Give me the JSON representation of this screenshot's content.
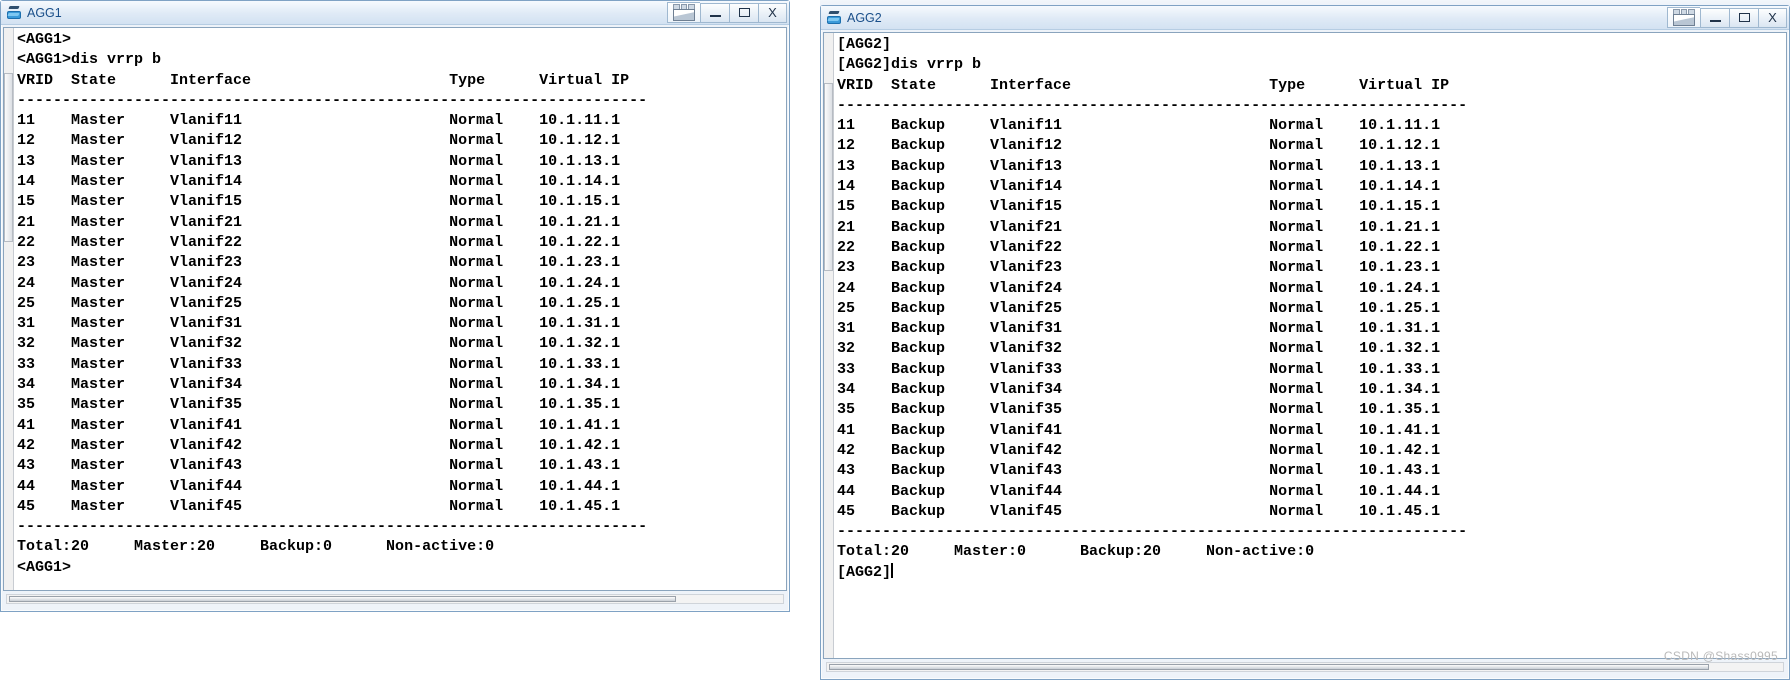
{
  "background_app": {
    "toolbar_hint": "▭ ▤ ▥ ▦ ▧ ▨ ▩ ▭ ▤ ▥ ▦ ▧ ▨ ▩ ▭ ▤ ▥ ▦ ▧ ▨ ▩ ▭ ▤ ▥ ▦ ▧ ▨"
  },
  "windows": [
    {
      "id": "agg1",
      "title": "AGG1",
      "icon": "ensp-device-icon",
      "buttons": {
        "restore": "restore",
        "minimize": "–",
        "maximize": "▭",
        "close": "X"
      },
      "terminal": {
        "prompt_first": "<AGG1>",
        "command_line": "<AGG1>dis vrrp b",
        "header": "VRID  State      Interface                      Type      Virtual IP",
        "divider": "----------------------------------------------------------------------",
        "summary": "Total:20     Master:20     Backup:0      Non-active:0",
        "prompt_last": "<AGG1>",
        "columns": [
          "VRID",
          "State",
          "Interface",
          "Type",
          "Virtual IP"
        ],
        "rows": [
          [
            "11",
            "Master",
            "Vlanif11",
            "Normal",
            "10.1.11.1"
          ],
          [
            "12",
            "Master",
            "Vlanif12",
            "Normal",
            "10.1.12.1"
          ],
          [
            "13",
            "Master",
            "Vlanif13",
            "Normal",
            "10.1.13.1"
          ],
          [
            "14",
            "Master",
            "Vlanif14",
            "Normal",
            "10.1.14.1"
          ],
          [
            "15",
            "Master",
            "Vlanif15",
            "Normal",
            "10.1.15.1"
          ],
          [
            "21",
            "Master",
            "Vlanif21",
            "Normal",
            "10.1.21.1"
          ],
          [
            "22",
            "Master",
            "Vlanif22",
            "Normal",
            "10.1.22.1"
          ],
          [
            "23",
            "Master",
            "Vlanif23",
            "Normal",
            "10.1.23.1"
          ],
          [
            "24",
            "Master",
            "Vlanif24",
            "Normal",
            "10.1.24.1"
          ],
          [
            "25",
            "Master",
            "Vlanif25",
            "Normal",
            "10.1.25.1"
          ],
          [
            "31",
            "Master",
            "Vlanif31",
            "Normal",
            "10.1.31.1"
          ],
          [
            "32",
            "Master",
            "Vlanif32",
            "Normal",
            "10.1.32.1"
          ],
          [
            "33",
            "Master",
            "Vlanif33",
            "Normal",
            "10.1.33.1"
          ],
          [
            "34",
            "Master",
            "Vlanif34",
            "Normal",
            "10.1.34.1"
          ],
          [
            "35",
            "Master",
            "Vlanif35",
            "Normal",
            "10.1.35.1"
          ],
          [
            "41",
            "Master",
            "Vlanif41",
            "Normal",
            "10.1.41.1"
          ],
          [
            "42",
            "Master",
            "Vlanif42",
            "Normal",
            "10.1.42.1"
          ],
          [
            "43",
            "Master",
            "Vlanif43",
            "Normal",
            "10.1.43.1"
          ],
          [
            "44",
            "Master",
            "Vlanif44",
            "Normal",
            "10.1.44.1"
          ],
          [
            "45",
            "Master",
            "Vlanif45",
            "Normal",
            "10.1.45.1"
          ]
        ],
        "totals": {
          "total": "20",
          "master": "20",
          "backup": "0",
          "non_active": "0"
        }
      }
    },
    {
      "id": "agg2",
      "title": "AGG2",
      "icon": "ensp-device-icon",
      "buttons": {
        "restore": "restore",
        "minimize": "–",
        "maximize": "▭",
        "close": "X"
      },
      "terminal": {
        "prompt_first": "[AGG2]",
        "command_line": "[AGG2]dis vrrp b",
        "header": "VRID  State      Interface                      Type      Virtual IP",
        "divider": "----------------------------------------------------------------------",
        "summary": "Total:20     Master:0      Backup:20     Non-active:0",
        "prompt_last": "[AGG2]",
        "columns": [
          "VRID",
          "State",
          "Interface",
          "Type",
          "Virtual IP"
        ],
        "rows": [
          [
            "11",
            "Backup",
            "Vlanif11",
            "Normal",
            "10.1.11.1"
          ],
          [
            "12",
            "Backup",
            "Vlanif12",
            "Normal",
            "10.1.12.1"
          ],
          [
            "13",
            "Backup",
            "Vlanif13",
            "Normal",
            "10.1.13.1"
          ],
          [
            "14",
            "Backup",
            "Vlanif14",
            "Normal",
            "10.1.14.1"
          ],
          [
            "15",
            "Backup",
            "Vlanif15",
            "Normal",
            "10.1.15.1"
          ],
          [
            "21",
            "Backup",
            "Vlanif21",
            "Normal",
            "10.1.21.1"
          ],
          [
            "22",
            "Backup",
            "Vlanif22",
            "Normal",
            "10.1.22.1"
          ],
          [
            "23",
            "Backup",
            "Vlanif23",
            "Normal",
            "10.1.23.1"
          ],
          [
            "24",
            "Backup",
            "Vlanif24",
            "Normal",
            "10.1.24.1"
          ],
          [
            "25",
            "Backup",
            "Vlanif25",
            "Normal",
            "10.1.25.1"
          ],
          [
            "31",
            "Backup",
            "Vlanif31",
            "Normal",
            "10.1.31.1"
          ],
          [
            "32",
            "Backup",
            "Vlanif32",
            "Normal",
            "10.1.32.1"
          ],
          [
            "33",
            "Backup",
            "Vlanif33",
            "Normal",
            "10.1.33.1"
          ],
          [
            "34",
            "Backup",
            "Vlanif34",
            "Normal",
            "10.1.34.1"
          ],
          [
            "35",
            "Backup",
            "Vlanif35",
            "Normal",
            "10.1.35.1"
          ],
          [
            "41",
            "Backup",
            "Vlanif41",
            "Normal",
            "10.1.41.1"
          ],
          [
            "42",
            "Backup",
            "Vlanif42",
            "Normal",
            "10.1.42.1"
          ],
          [
            "43",
            "Backup",
            "Vlanif43",
            "Normal",
            "10.1.43.1"
          ],
          [
            "44",
            "Backup",
            "Vlanif44",
            "Normal",
            "10.1.44.1"
          ],
          [
            "45",
            "Backup",
            "Vlanif45",
            "Normal",
            "10.1.45.1"
          ]
        ],
        "totals": {
          "total": "20",
          "master": "0",
          "backup": "20",
          "non_active": "0"
        }
      }
    }
  ],
  "watermark": "CSDN @Shass0995",
  "colors": {
    "title_text": "#1a4f8a",
    "window_border": "#7fa2c4",
    "terminal_bg": "#ffffff",
    "terminal_fg": "#000000"
  }
}
